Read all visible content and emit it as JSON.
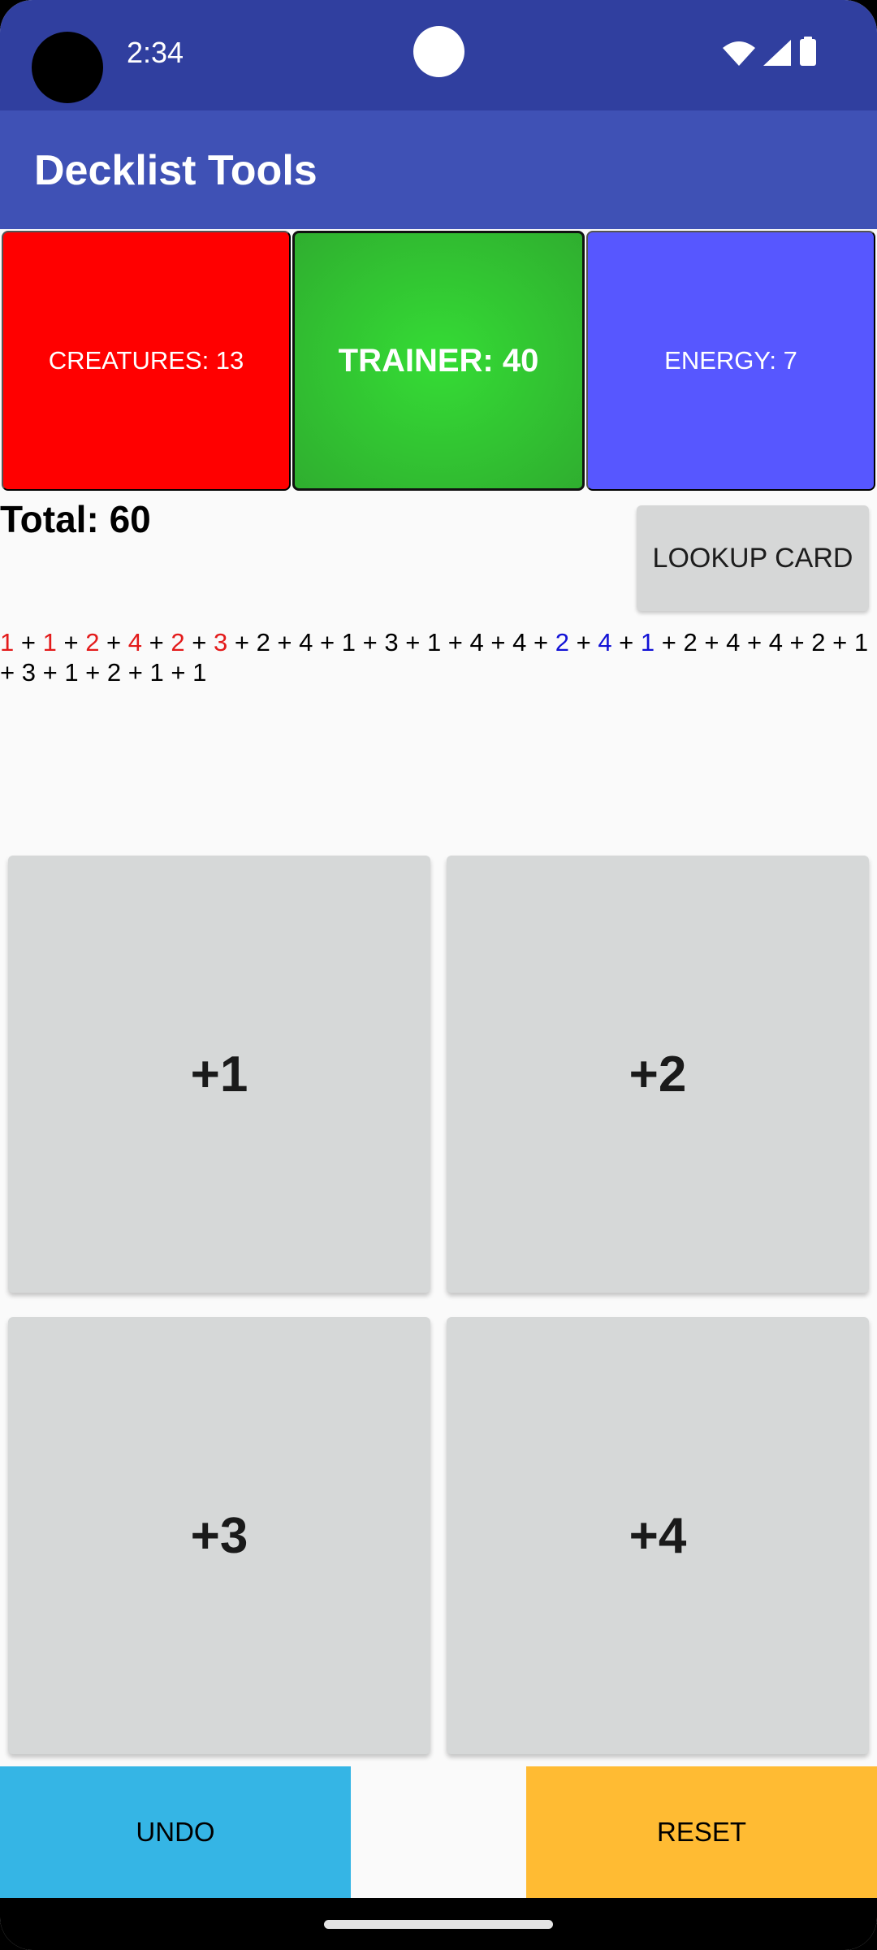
{
  "status_bar": {
    "time": "2:34",
    "icons": [
      "wifi-icon",
      "cellular-signal-icon",
      "battery-icon"
    ]
  },
  "app_bar": {
    "title": "Decklist Tools"
  },
  "categories": [
    {
      "name": "creatures",
      "label": "CREATURES: 13",
      "color": "#ff0000",
      "selected": false
    },
    {
      "name": "trainer",
      "label": "TRAINER: 40",
      "color": "#33cc33",
      "selected": true
    },
    {
      "name": "energy",
      "label": "ENERGY: 7",
      "color": "#5757ff",
      "selected": false
    }
  ],
  "total": {
    "label": "Total: 60"
  },
  "lookup_button": {
    "label": "LOOKUP CARD"
  },
  "history": {
    "entries": [
      {
        "value": "1",
        "type": "creature"
      },
      {
        "value": "1",
        "type": "creature"
      },
      {
        "value": "2",
        "type": "creature"
      },
      {
        "value": "4",
        "type": "creature"
      },
      {
        "value": "2",
        "type": "creature"
      },
      {
        "value": "3",
        "type": "creature"
      },
      {
        "value": "2",
        "type": "trainer"
      },
      {
        "value": "4",
        "type": "trainer"
      },
      {
        "value": "1",
        "type": "trainer"
      },
      {
        "value": "3",
        "type": "trainer"
      },
      {
        "value": "1",
        "type": "trainer"
      },
      {
        "value": "4",
        "type": "trainer"
      },
      {
        "value": "4",
        "type": "trainer"
      },
      {
        "value": "2",
        "type": "energy"
      },
      {
        "value": "4",
        "type": "energy"
      },
      {
        "value": "1",
        "type": "energy"
      },
      {
        "value": "2",
        "type": "trainer"
      },
      {
        "value": "4",
        "type": "trainer"
      },
      {
        "value": "4",
        "type": "trainer"
      },
      {
        "value": "2",
        "type": "trainer"
      },
      {
        "value": "1",
        "type": "trainer"
      },
      {
        "value": "3",
        "type": "trainer"
      },
      {
        "value": "1",
        "type": "trainer"
      },
      {
        "value": "2",
        "type": "trainer"
      },
      {
        "value": "1",
        "type": "trainer"
      },
      {
        "value": "1",
        "type": "trainer"
      }
    ],
    "separator": " + ",
    "colors": {
      "creature": "#e31b1b",
      "trainer": "#000000",
      "energy": "#1212d6"
    }
  },
  "add_buttons": [
    {
      "label": "+1"
    },
    {
      "label": "+2"
    },
    {
      "label": "+3"
    },
    {
      "label": "+4"
    }
  ],
  "actions": {
    "undo_label": "UNDO",
    "undo_color": "#35b5e5",
    "reset_label": "RESET",
    "reset_color": "#ffbb33"
  }
}
